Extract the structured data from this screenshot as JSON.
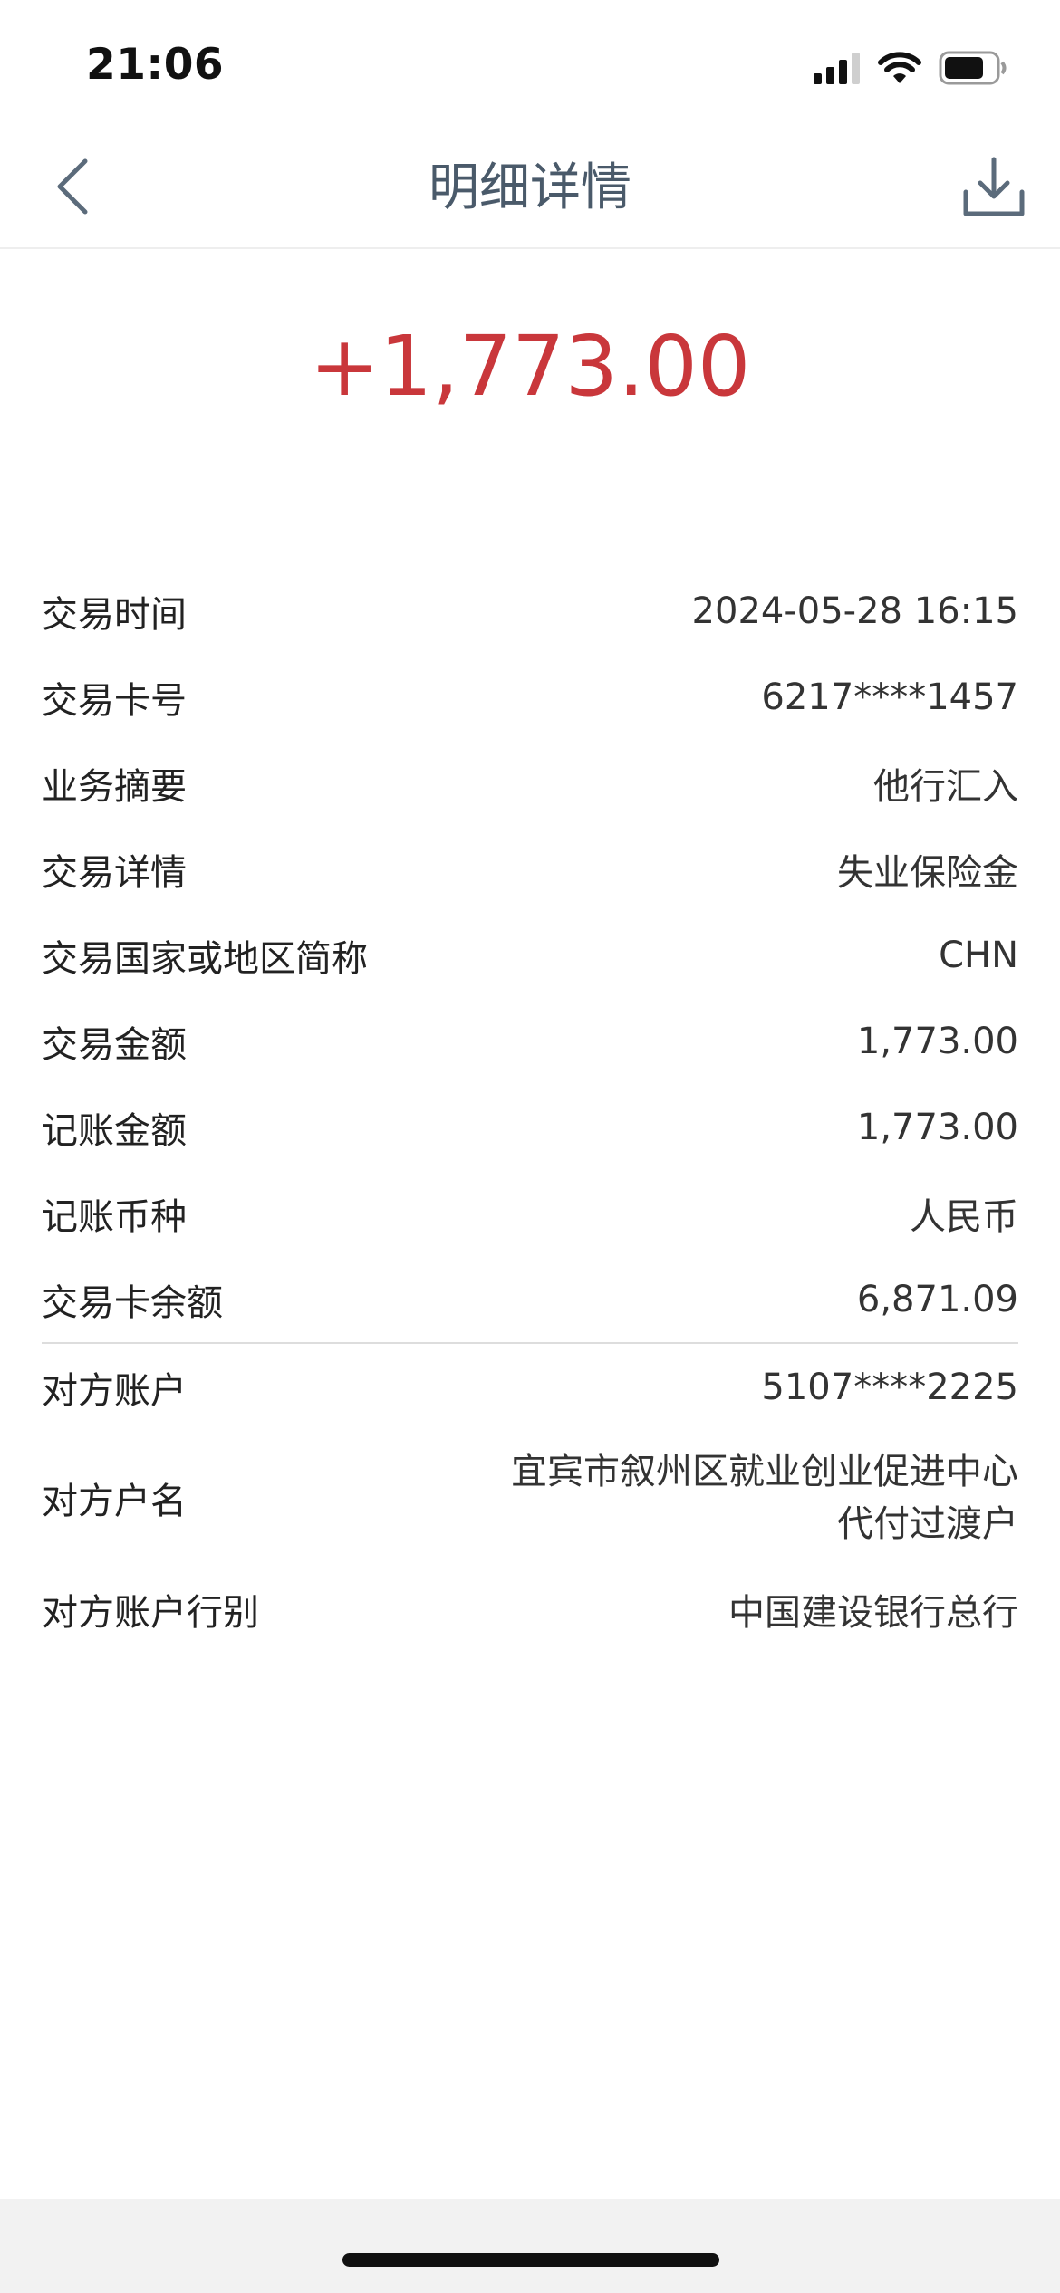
{
  "status_bar": {
    "time": "21:06"
  },
  "nav": {
    "title": "明细详情",
    "back_icon": "chevron-left-icon",
    "download_icon": "download-icon"
  },
  "amount": "+1,773.00",
  "colors": {
    "amount": "#c9373b",
    "title": "#4a5a6a",
    "icon": "#5b6b7b"
  },
  "details": [
    {
      "label": "交易时间",
      "value": "2024-05-28 16:15"
    },
    {
      "label": "交易卡号",
      "value": "6217****1457"
    },
    {
      "label": "业务摘要",
      "value": "他行汇入"
    },
    {
      "label": "交易详情",
      "value": "失业保险金"
    },
    {
      "label": "交易国家或地区简称",
      "value": "CHN"
    },
    {
      "label": "交易金额",
      "value": "1,773.00"
    },
    {
      "label": "记账金额",
      "value": "1,773.00"
    },
    {
      "label": "记账币种",
      "value": "人民币"
    },
    {
      "label": "交易卡余额",
      "value": "6,871.09"
    }
  ],
  "counterparty": [
    {
      "label": "对方账户",
      "value": "5107****2225"
    },
    {
      "label": "对方户名",
      "value_line1": "宜宾市叙州区就业创业促进中心",
      "value_line2": "代付过渡户"
    },
    {
      "label": "对方账户行别",
      "value": "中国建设银行总行"
    }
  ]
}
